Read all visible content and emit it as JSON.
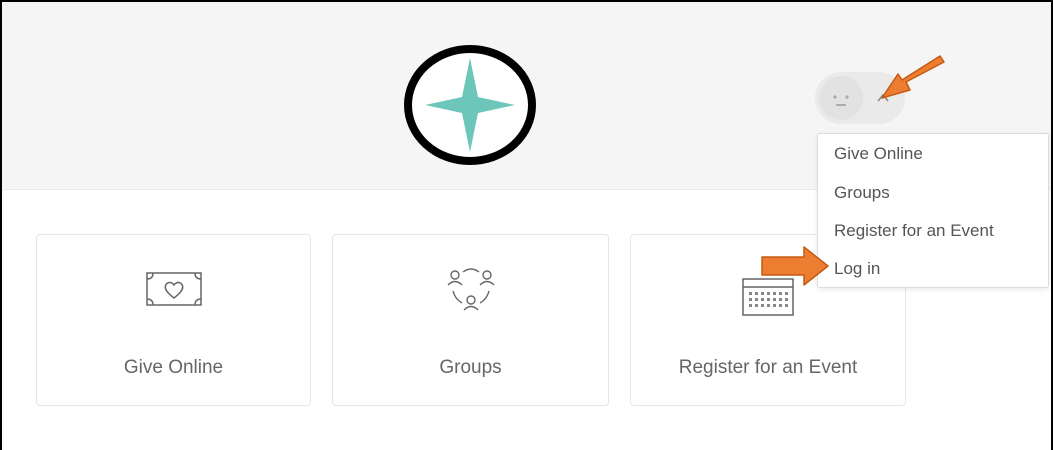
{
  "header": {
    "logo_icon": "four-point-star-logo",
    "accent_color": "#6cc7ba"
  },
  "user_menu": {
    "avatar_icon": "neutral-face-icon",
    "toggle_icon": "chevron-up-icon",
    "items": [
      {
        "label": "Give Online"
      },
      {
        "label": "Groups"
      },
      {
        "label": "Register for an Event"
      },
      {
        "label": "Log in"
      }
    ]
  },
  "cards": [
    {
      "label": "Give Online",
      "icon": "money-heart-icon"
    },
    {
      "label": "Groups",
      "icon": "people-group-icon"
    },
    {
      "label": "Register for an Event",
      "icon": "calendar-icon"
    }
  ],
  "annotations": {
    "arrow_color": "#ed7d31"
  }
}
